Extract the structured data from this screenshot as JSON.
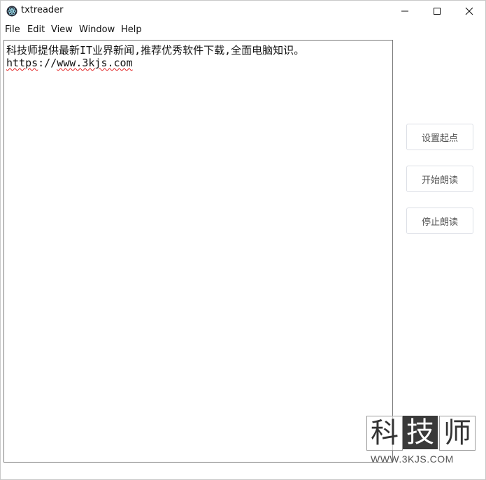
{
  "window": {
    "title": "txtreader"
  },
  "menu": [
    "File",
    "Edit",
    "View",
    "Window",
    "Help"
  ],
  "content": {
    "line1": "科技师提供最新IT业界新闻,推荐优秀软件下载,全面电脑知识。",
    "line2_prefix": "https",
    "line2_mid": "://",
    "line2_url": "www.3kjs.com"
  },
  "buttons": {
    "set_start": "设置起点",
    "start_read": "开始朗读",
    "stop_read": "停止朗读"
  },
  "watermark": {
    "chars": [
      "科",
      "技",
      "师"
    ],
    "url": "WWW.3KJS.COM"
  },
  "icons": {
    "app": "electron-atom-icon",
    "minimize": "minimize-icon",
    "maximize": "maximize-icon",
    "close": "close-icon"
  }
}
